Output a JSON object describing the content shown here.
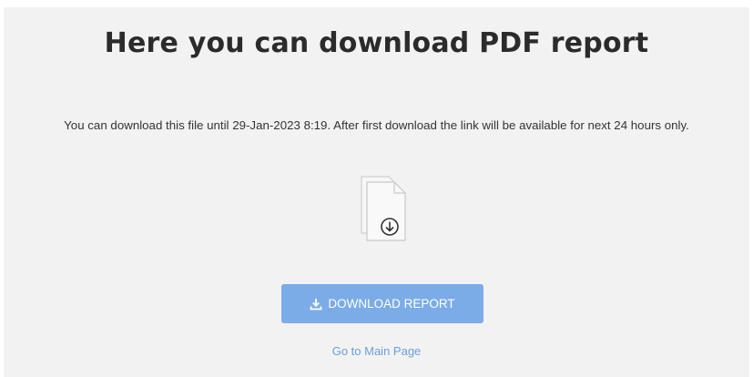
{
  "page": {
    "title": "Here you can download PDF report",
    "note": "You can download this file until 29-Jan-2023 8:19. After first download the link will be available for next 24 hours only.",
    "file_icon": "file-download-icon",
    "download_button_label": "DOWNLOAD REPORT",
    "download_button_icon": "download-icon",
    "main_page_link": "Go to Main Page"
  },
  "colors": {
    "panel_background": "#f2f2f2",
    "button_background": "#7bace8",
    "link": "#6a9fd8",
    "title": "#2b2b2b"
  }
}
